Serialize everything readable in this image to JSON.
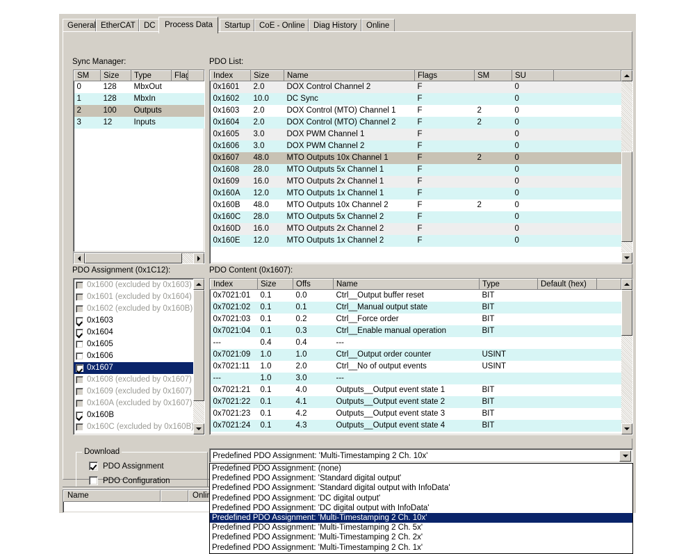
{
  "tabs": [
    {
      "label": "General",
      "selected": false
    },
    {
      "label": "EtherCAT",
      "selected": false
    },
    {
      "label": "DC",
      "selected": false
    },
    {
      "label": "Process Data",
      "selected": true
    },
    {
      "label": "Startup",
      "selected": false
    },
    {
      "label": "CoE - Online",
      "selected": false
    },
    {
      "label": "Diag History",
      "selected": false
    },
    {
      "label": "Online",
      "selected": false
    }
  ],
  "sync_manager": {
    "label": "Sync Manager:",
    "columns": [
      "SM",
      "Size",
      "Type",
      "Flags"
    ],
    "rows": [
      {
        "sm": "0",
        "size": "128",
        "type": "MbxOut",
        "flags": "",
        "style": "r-white"
      },
      {
        "sm": "1",
        "size": "128",
        "type": "MbxIn",
        "flags": "",
        "style": "r-cyan"
      },
      {
        "sm": "2",
        "size": "100",
        "type": "Outputs",
        "flags": "",
        "style": "r-sel"
      },
      {
        "sm": "3",
        "size": "12",
        "type": "Inputs",
        "flags": "",
        "style": "r-cyan"
      }
    ]
  },
  "pdo_list": {
    "label": "PDO List:",
    "columns": [
      "Index",
      "Size",
      "Name",
      "Flags",
      "SM",
      "SU"
    ],
    "rows": [
      {
        "index": "0x1601",
        "size": "2.0",
        "name": "DOX Control Channel 2",
        "flags": "F",
        "sm": "",
        "su": "0",
        "style": "r-alt"
      },
      {
        "index": "0x1602",
        "size": "10.0",
        "name": "DC Sync",
        "flags": "F",
        "sm": "",
        "su": "0",
        "style": "r-cyan"
      },
      {
        "index": "0x1603",
        "size": "2.0",
        "name": "DOX Control (MTO) Channel 1",
        "flags": "F",
        "sm": "2",
        "su": "0",
        "style": "r-white"
      },
      {
        "index": "0x1604",
        "size": "2.0",
        "name": "DOX Control (MTO) Channel 2",
        "flags": "F",
        "sm": "2",
        "su": "0",
        "style": "r-cyan"
      },
      {
        "index": "0x1605",
        "size": "3.0",
        "name": "DOX PWM Channel 1",
        "flags": "F",
        "sm": "",
        "su": "0",
        "style": "r-alt"
      },
      {
        "index": "0x1606",
        "size": "3.0",
        "name": "DOX PWM Channel 2",
        "flags": "F",
        "sm": "",
        "su": "0",
        "style": "r-cyan"
      },
      {
        "index": "0x1607",
        "size": "48.0",
        "name": "MTO Outputs 10x Channel 1",
        "flags": "F",
        "sm": "2",
        "su": "0",
        "style": "r-sel"
      },
      {
        "index": "0x1608",
        "size": "28.0",
        "name": "MTO Outputs 5x Channel 1",
        "flags": "F",
        "sm": "",
        "su": "0",
        "style": "r-cyan"
      },
      {
        "index": "0x1609",
        "size": "16.0",
        "name": "MTO Outputs 2x Channel 1",
        "flags": "F",
        "sm": "",
        "su": "0",
        "style": "r-alt"
      },
      {
        "index": "0x160A",
        "size": "12.0",
        "name": "MTO Outputs 1x Channel 1",
        "flags": "F",
        "sm": "",
        "su": "0",
        "style": "r-cyan"
      },
      {
        "index": "0x160B",
        "size": "48.0",
        "name": "MTO Outputs 10x Channel 2",
        "flags": "F",
        "sm": "2",
        "su": "0",
        "style": "r-white"
      },
      {
        "index": "0x160C",
        "size": "28.0",
        "name": "MTO Outputs 5x Channel 2",
        "flags": "F",
        "sm": "",
        "su": "0",
        "style": "r-cyan"
      },
      {
        "index": "0x160D",
        "size": "16.0",
        "name": "MTO Outputs 2x Channel 2",
        "flags": "F",
        "sm": "",
        "su": "0",
        "style": "r-alt"
      },
      {
        "index": "0x160E",
        "size": "12.0",
        "name": "MTO Outputs 1x Channel 2",
        "flags": "F",
        "sm": "",
        "su": "0",
        "style": "r-cyan"
      }
    ]
  },
  "pdo_assignment": {
    "label": "PDO Assignment (0x1C12):",
    "items": [
      {
        "text": "0x1600 (excluded by 0x1603)",
        "checked": false,
        "disabled": true,
        "selected": false
      },
      {
        "text": "0x1601 (excluded by 0x1604)",
        "checked": false,
        "disabled": true,
        "selected": false
      },
      {
        "text": "0x1602 (excluded by 0x160B)",
        "checked": false,
        "disabled": true,
        "selected": false
      },
      {
        "text": "0x1603",
        "checked": true,
        "disabled": false,
        "selected": false
      },
      {
        "text": "0x1604",
        "checked": true,
        "disabled": false,
        "selected": false
      },
      {
        "text": "0x1605",
        "checked": false,
        "disabled": false,
        "selected": false
      },
      {
        "text": "0x1606",
        "checked": false,
        "disabled": false,
        "selected": false
      },
      {
        "text": "0x1607",
        "checked": true,
        "disabled": false,
        "selected": true
      },
      {
        "text": "0x1608 (excluded by 0x1607)",
        "checked": false,
        "disabled": true,
        "selected": false
      },
      {
        "text": "0x1609 (excluded by 0x1607)",
        "checked": false,
        "disabled": true,
        "selected": false
      },
      {
        "text": "0x160A (excluded by 0x1607)",
        "checked": false,
        "disabled": true,
        "selected": false
      },
      {
        "text": "0x160B",
        "checked": true,
        "disabled": false,
        "selected": false
      },
      {
        "text": "0x160C (excluded by 0x160B)",
        "checked": false,
        "disabled": true,
        "selected": false
      }
    ]
  },
  "pdo_content": {
    "label": "PDO Content (0x1607):",
    "columns": [
      "Index",
      "Size",
      "Offs",
      "Name",
      "Type",
      "Default (hex)"
    ],
    "rows": [
      {
        "index": "0x7021:01",
        "size": "0.1",
        "offs": "0.0",
        "name": "Ctrl__Output buffer reset",
        "type": "BIT",
        "default": "",
        "style": "r-white"
      },
      {
        "index": "0x7021:02",
        "size": "0.1",
        "offs": "0.1",
        "name": "Ctrl__Manual output state",
        "type": "BIT",
        "default": "",
        "style": "r-cyan"
      },
      {
        "index": "0x7021:03",
        "size": "0.1",
        "offs": "0.2",
        "name": "Ctrl__Force order",
        "type": "BIT",
        "default": "",
        "style": "r-white"
      },
      {
        "index": "0x7021:04",
        "size": "0.1",
        "offs": "0.3",
        "name": "Ctrl__Enable manual operation",
        "type": "BIT",
        "default": "",
        "style": "r-cyan"
      },
      {
        "index": "---",
        "size": "0.4",
        "offs": "0.4",
        "name": "---",
        "type": "",
        "default": "",
        "style": "r-white"
      },
      {
        "index": "0x7021:09",
        "size": "1.0",
        "offs": "1.0",
        "name": "Ctrl__Output order counter",
        "type": "USINT",
        "default": "",
        "style": "r-cyan"
      },
      {
        "index": "0x7021:11",
        "size": "1.0",
        "offs": "2.0",
        "name": "Ctrl__No of output events",
        "type": "USINT",
        "default": "",
        "style": "r-white"
      },
      {
        "index": "---",
        "size": "1.0",
        "offs": "3.0",
        "name": "---",
        "type": "",
        "default": "",
        "style": "r-cyan"
      },
      {
        "index": "0x7021:21",
        "size": "0.1",
        "offs": "4.0",
        "name": "Outputs__Output event state 1",
        "type": "BIT",
        "default": "",
        "style": "r-white"
      },
      {
        "index": "0x7021:22",
        "size": "0.1",
        "offs": "4.1",
        "name": "Outputs__Output event state 2",
        "type": "BIT",
        "default": "",
        "style": "r-cyan"
      },
      {
        "index": "0x7021:23",
        "size": "0.1",
        "offs": "4.2",
        "name": "Outputs__Output event state 3",
        "type": "BIT",
        "default": "",
        "style": "r-white"
      },
      {
        "index": "0x7021:24",
        "size": "0.1",
        "offs": "4.3",
        "name": "Outputs__Output event state 4",
        "type": "BIT",
        "default": "",
        "style": "r-cyan"
      }
    ]
  },
  "download": {
    "caption": "Download",
    "pdo_assignment_label": "PDO Assignment",
    "pdo_assignment_checked": true,
    "pdo_configuration_label": "PDO Configuration",
    "pdo_configuration_checked": false
  },
  "predefined": {
    "selected": "Predefined PDO Assignment: 'Multi-Timestamping 2 Ch. 10x'",
    "options": [
      {
        "text": "Predefined PDO Assignment: (none)",
        "selected": false
      },
      {
        "text": "Predefined PDO Assignment: 'Standard digital output'",
        "selected": false
      },
      {
        "text": "Predefined PDO Assignment: 'Standard digital output with InfoData'",
        "selected": false
      },
      {
        "text": "Predefined PDO Assignment: 'DC digital output'",
        "selected": false
      },
      {
        "text": "Predefined PDO Assignment: 'DC digital output with InfoData'",
        "selected": false
      },
      {
        "text": "Predefined PDO Assignment: 'Multi-Timestamping 2 Ch. 10x'",
        "selected": true
      },
      {
        "text": "Predefined PDO Assignment: 'Multi-Timestamping 2 Ch. 5x'",
        "selected": false
      },
      {
        "text": "Predefined PDO Assignment: 'Multi-Timestamping 2 Ch. 2x'",
        "selected": false
      },
      {
        "text": "Predefined PDO Assignment: 'Multi-Timestamping 2 Ch. 1x'",
        "selected": false
      }
    ]
  },
  "bottom_grid": {
    "columns": [
      "Name",
      "",
      "Online"
    ]
  }
}
